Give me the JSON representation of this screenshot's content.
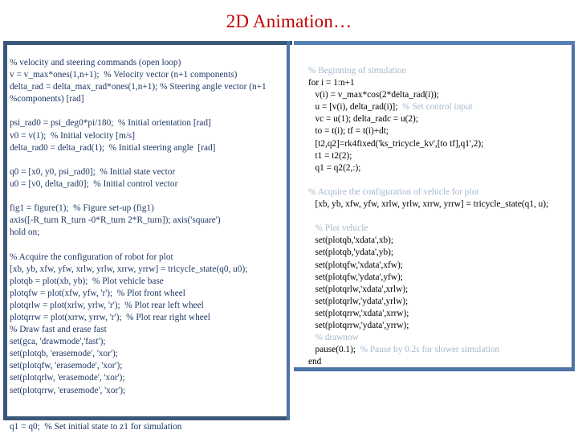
{
  "slide": {
    "title": "2D Animation…",
    "title_color": "#c00000",
    "accent_dark": "#3c5878",
    "accent_light": "#5680b4",
    "left_text_color": "#1f3864",
    "right_text_color": "#000000",
    "right_comment_color": "#a6b8cc"
  },
  "left_panel": {
    "name": "matlab-setup-code",
    "lines": [
      "% velocity and steering commands (open loop)",
      "v = v_max*ones(1,n+1);  % Velocity vector (n+1 components)",
      "delta_rad = delta_max_rad*ones(1,n+1); % Steering angle vector (n+1",
      "%components) [rad]",
      "",
      "psi_rad0 = psi_deg0*pi/180;  % Initial orientation [rad]",
      "v0 = v(1);  % Initial velocity [m/s]",
      "delta_rad0 = delta_rad(1);  % Initial steering angle  [rad]",
      "",
      "q0 = [x0, y0, psi_rad0];  % Initial state vector",
      "u0 = [v0, delta_rad0];  % Initial control vector",
      "",
      "fig1 = figure(1);  % Figure set-up (fig1)",
      "axis([-R_turn R_turn -0*R_turn 2*R_turn]); axis('square')",
      "hold on;",
      "",
      "% Acquire the configuration of robot for plot",
      "[xb, yb, xfw, yfw, xrlw, yrlw, xrrw, yrrw] = tricycle_state(q0, u0);",
      "plotqb = plot(xb, yb);  % Plot vehicle base",
      "plotqfw = plot(xfw, yfw, 'r');  % Plot front wheel",
      "plotqrlw = plot(xrlw, yrlw, 'r');  % Plot rear left wheel",
      "plotqrrw = plot(xrrw, yrrw, 'r');  % Plot rear right wheel",
      "% Draw fast and erase fast",
      "set(gca, 'drawmode','fast');",
      "set(plotqb, 'erasemode', 'xor');",
      "set(plotqfw, 'erasemode', 'xor');",
      "set(plotqrlw, 'erasemode', 'xor');",
      "set(plotqrrw, 'erasemode', 'xor');",
      "",
      "",
      "q1 = q0;  % Set initial state to z1 for simulation"
    ]
  },
  "right_panel": {
    "name": "matlab-simulation-loop-code",
    "lines": [
      {
        "indent": 0,
        "segments": [
          {
            "text": "% Beginning of simulation",
            "style": "comment"
          }
        ]
      },
      {
        "indent": 0,
        "segments": [
          {
            "text": "for i = 1:n+1",
            "style": "code"
          }
        ]
      },
      {
        "indent": 1,
        "segments": [
          {
            "text": "v(i) = v_max*cos(2*delta_rad(i));",
            "style": "code"
          }
        ]
      },
      {
        "indent": 1,
        "segments": [
          {
            "text": "u = [v(i), delta_rad(i)];  ",
            "style": "code"
          },
          {
            "text": "% Set control input",
            "style": "comment"
          }
        ]
      },
      {
        "indent": 1,
        "segments": [
          {
            "text": "vc = u(1); delta_radc = u(2);",
            "style": "code"
          }
        ]
      },
      {
        "indent": 1,
        "segments": [
          {
            "text": "to = t(i); tf = t(i)+dt;",
            "style": "code"
          }
        ]
      },
      {
        "indent": 1,
        "segments": [
          {
            "text": "[t2,q2]=rk4fixed('ks_tricycle_kv',[to tf],q1',2);",
            "style": "code"
          }
        ]
      },
      {
        "indent": 1,
        "segments": [
          {
            "text": "t1 = t2(2);",
            "style": "code"
          }
        ]
      },
      {
        "indent": 1,
        "segments": [
          {
            "text": "q1 = q2(2,:);",
            "style": "code"
          }
        ]
      },
      {
        "indent": 0,
        "segments": [
          {
            "text": "",
            "style": "code"
          }
        ]
      },
      {
        "indent": 0,
        "segments": [
          {
            "text": "% Acquire the configuration of vehicle for plot",
            "style": "comment"
          }
        ]
      },
      {
        "indent": 1,
        "segments": [
          {
            "text": "[xb, yb, xfw, yfw, xrlw, yrlw, xrrw, yrrw] = tricycle_state(q1, u);",
            "style": "code"
          }
        ]
      },
      {
        "indent": 0,
        "segments": [
          {
            "text": "",
            "style": "code"
          }
        ]
      },
      {
        "indent": 1,
        "segments": [
          {
            "text": "% Plot vehicle",
            "style": "comment"
          }
        ]
      },
      {
        "indent": 1,
        "segments": [
          {
            "text": "set(plotqb,'xdata',xb);",
            "style": "code"
          }
        ]
      },
      {
        "indent": 1,
        "segments": [
          {
            "text": "set(plotqb,'ydata',yb);",
            "style": "code"
          }
        ]
      },
      {
        "indent": 1,
        "segments": [
          {
            "text": "set(plotqfw,'xdata',xfw);",
            "style": "code"
          }
        ]
      },
      {
        "indent": 1,
        "segments": [
          {
            "text": "set(plotqfw,'ydata',yfw);",
            "style": "code"
          }
        ]
      },
      {
        "indent": 1,
        "segments": [
          {
            "text": "set(plotqrlw,'xdata',xrlw);",
            "style": "code"
          }
        ]
      },
      {
        "indent": 1,
        "segments": [
          {
            "text": "set(plotqrlw,'ydata',yrlw);",
            "style": "code"
          }
        ]
      },
      {
        "indent": 1,
        "segments": [
          {
            "text": "set(plotqrrw,'xdata',xrrw);",
            "style": "code"
          }
        ]
      },
      {
        "indent": 1,
        "segments": [
          {
            "text": "set(plotqrrw,'ydata',yrrw);",
            "style": "code"
          }
        ]
      },
      {
        "indent": 1,
        "segments": [
          {
            "text": "% drawnow",
            "style": "comment"
          }
        ]
      },
      {
        "indent": 1,
        "segments": [
          {
            "text": "pause(0.1);  ",
            "style": "code"
          },
          {
            "text": "% Pause by 0.2s for slower simulation",
            "style": "comment"
          }
        ]
      },
      {
        "indent": 0,
        "segments": [
          {
            "text": "end",
            "style": "code"
          }
        ]
      }
    ]
  }
}
